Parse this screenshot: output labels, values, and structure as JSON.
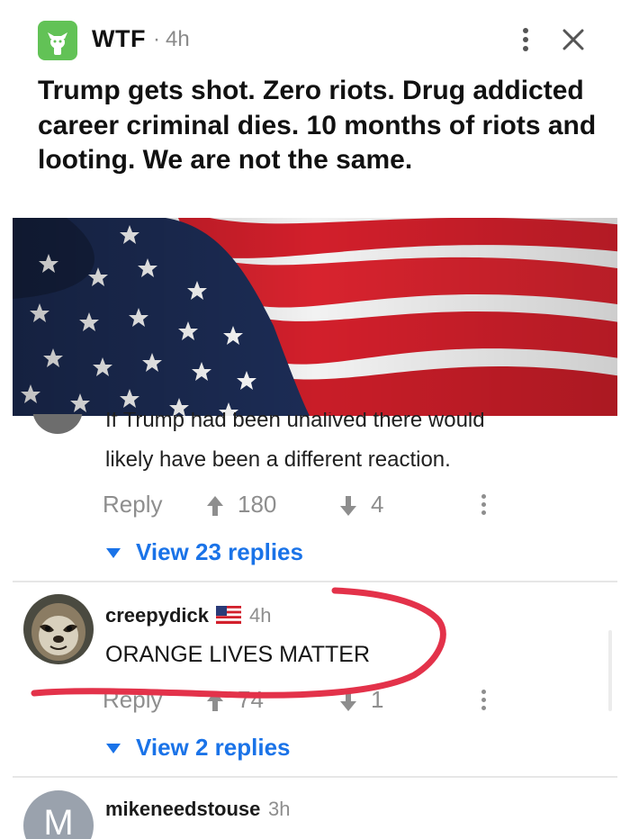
{
  "post": {
    "group_name": "WTF",
    "separator": "·",
    "age": "4h",
    "title": "Trump gets shot. Zero riots. Drug addicted career criminal dies. 10 months of riots and looting. We are not the same."
  },
  "comments": [
    {
      "text_cut": "If Trump had been unalived there would",
      "text": "likely have been a different reaction.",
      "reply_label": "Reply",
      "upvotes": "180",
      "downvotes": "4",
      "view_replies": "View 23 replies"
    },
    {
      "username": "creepydick",
      "age": "4h",
      "text": "ORANGE LIVES MATTER",
      "reply_label": "Reply",
      "upvotes": "74",
      "downvotes": "1",
      "view_replies": "View 2 replies"
    },
    {
      "username": "mikeneedstouse",
      "age": "3h",
      "avatar_letter": "M"
    }
  ],
  "colors": {
    "group_logo": "#62c256",
    "link_blue": "#1a73e8",
    "annotation_red": "#e3324a",
    "muted_gray": "#8e8e8e"
  }
}
